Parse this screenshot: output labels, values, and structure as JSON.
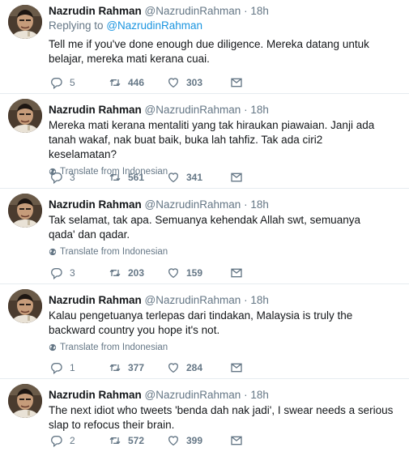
{
  "tweets": [
    {
      "name": "Nazrudin Rahman",
      "handle": "@NazrudinRahman",
      "time": "18h",
      "replying_label": "Replying to",
      "replying_to": "@NazrudinRahman",
      "text": "Tell me if you've done enough due diligence. Mereka datang untuk belajar, mereka mati kerana cuai.",
      "translate": "",
      "replies": "5",
      "retweets": "446",
      "likes": "303"
    },
    {
      "name": "Nazrudin Rahman",
      "handle": "@NazrudinRahman",
      "time": "18h",
      "text": "Mereka mati kerana mentaliti yang tak hiraukan piawaian. Janji ada tanah wakaf, nak buat baik, buka lah tahfiz. Tak ada ciri2 keselamatan?",
      "translate": "Translate from Indonesian",
      "replies": "3",
      "retweets": "561",
      "likes": "341"
    },
    {
      "name": "Nazrudin Rahman",
      "handle": "@NazrudinRahman",
      "time": "18h",
      "text": "Tak selamat, tak apa. Semuanya kehendak Allah swt, semuanya qada' dan qadar.",
      "translate": "Translate from Indonesian",
      "replies": "3",
      "retweets": "203",
      "likes": "159"
    },
    {
      "name": "Nazrudin Rahman",
      "handle": "@NazrudinRahman",
      "time": "18h",
      "text": "Kalau pengetuanya terlepas dari tindakan, Malaysia is truly the backward country you hope it's not.",
      "translate": "Translate from Indonesian",
      "replies": "1",
      "retweets": "377",
      "likes": "284"
    },
    {
      "name": "Nazrudin Rahman",
      "handle": "@NazrudinRahman",
      "time": "18h",
      "text": "The next idiot who tweets 'benda dah nak jadi', I swear needs a serious slap to refocus their brain.",
      "translate": "",
      "replies": "2",
      "retweets": "572",
      "likes": "399"
    }
  ],
  "icons": {
    "reply": "reply-icon",
    "retweet": "retweet-icon",
    "like": "heart-icon",
    "dm": "envelope-icon",
    "globe": "globe-icon"
  },
  "colors": {
    "name": "#14171a",
    "muted": "#657786",
    "mention": "#1b95e0",
    "divider": "#e6ecf0"
  }
}
